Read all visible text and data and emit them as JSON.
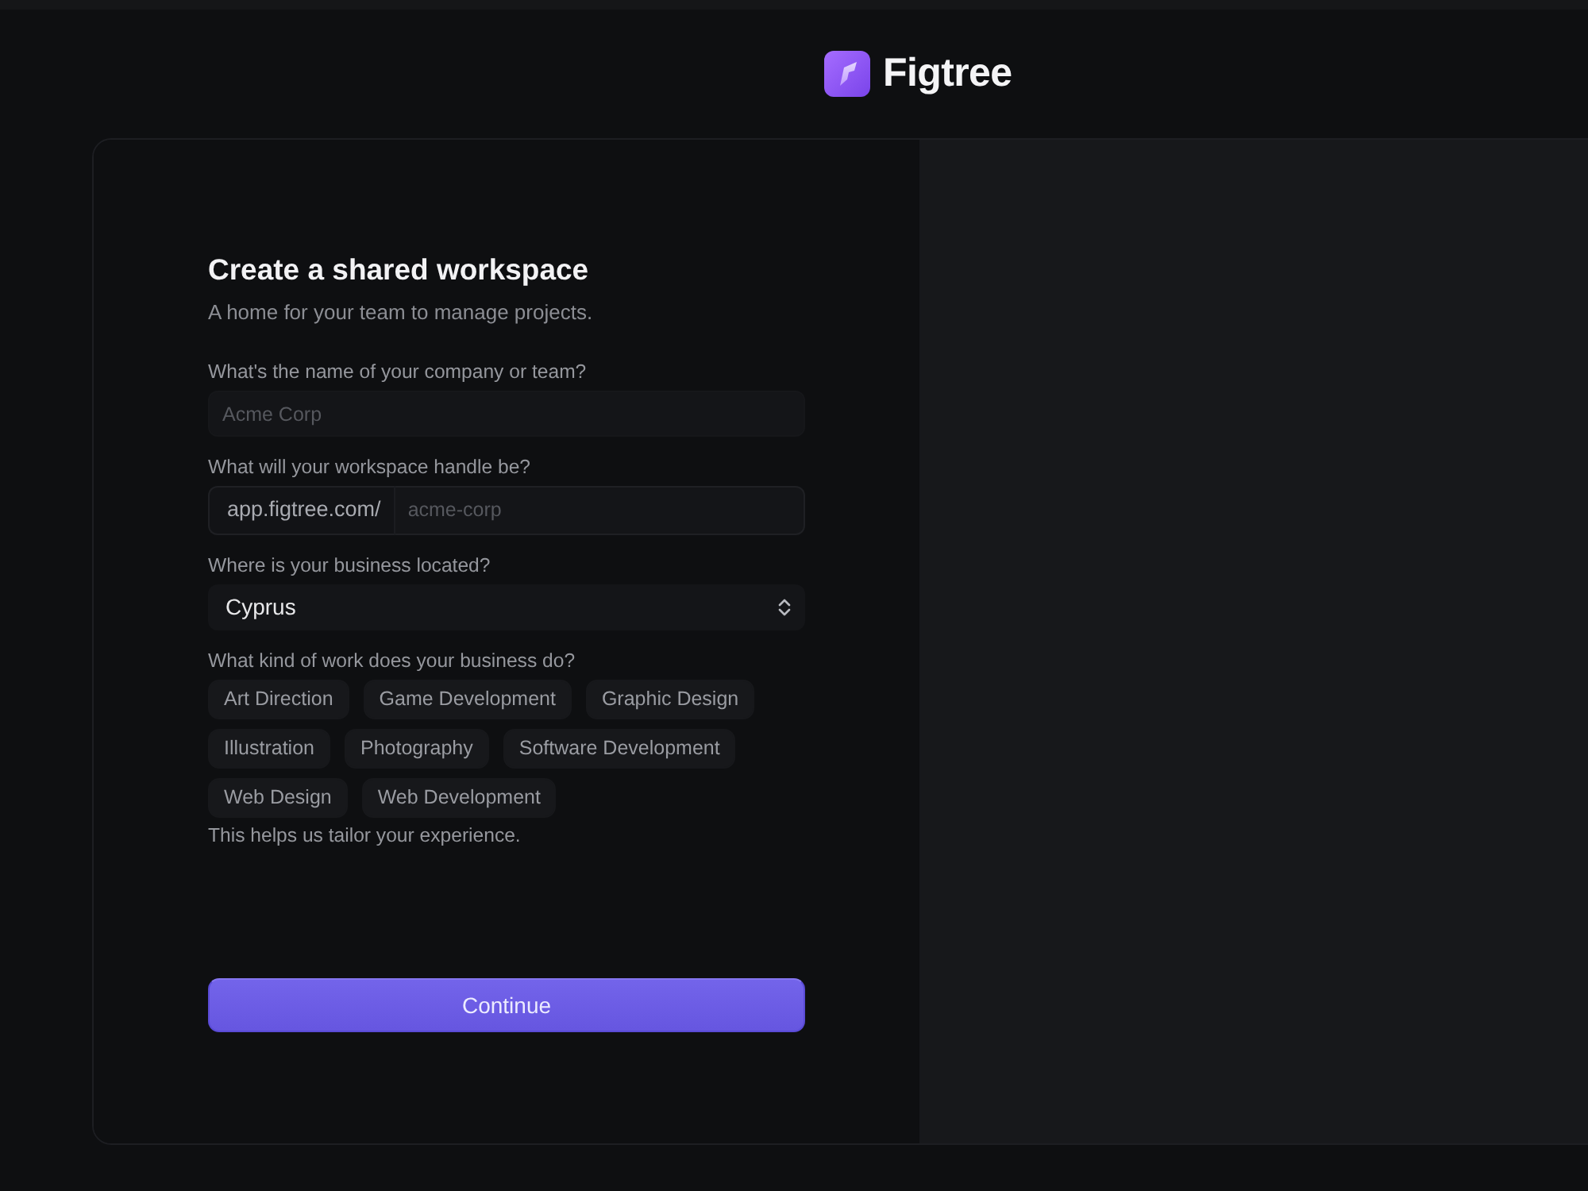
{
  "brand": {
    "name": "Figtree"
  },
  "form": {
    "title": "Create a shared workspace",
    "subtitle": "A home for your team to manage projects.",
    "fields": [
      {
        "kind": "text",
        "label": "What's the name of your company or team?",
        "placeholder": "Acme Corp"
      },
      {
        "kind": "prefixed",
        "label": "What will your workspace handle be?",
        "prefix": "app.figtree.com/",
        "placeholder": "acme-corp"
      },
      {
        "kind": "select",
        "label": "Where is your business located?",
        "value": "Cyprus"
      },
      {
        "kind": "chips",
        "label": "What kind of work does your business do?",
        "options": [
          {
            "label": "Art Direction",
            "selected": false
          },
          {
            "label": "Game Development",
            "selected": false
          },
          {
            "label": "Graphic Design",
            "selected": false
          },
          {
            "label": "Illustration",
            "selected": false
          },
          {
            "label": "Photography",
            "selected": false
          },
          {
            "label": "Software Development",
            "selected": false
          },
          {
            "label": "Web Design",
            "selected": false
          },
          {
            "label": "Web Development",
            "selected": false
          }
        ],
        "hint": "This helps us tailor your experience."
      }
    ],
    "submit": "Continue"
  }
}
